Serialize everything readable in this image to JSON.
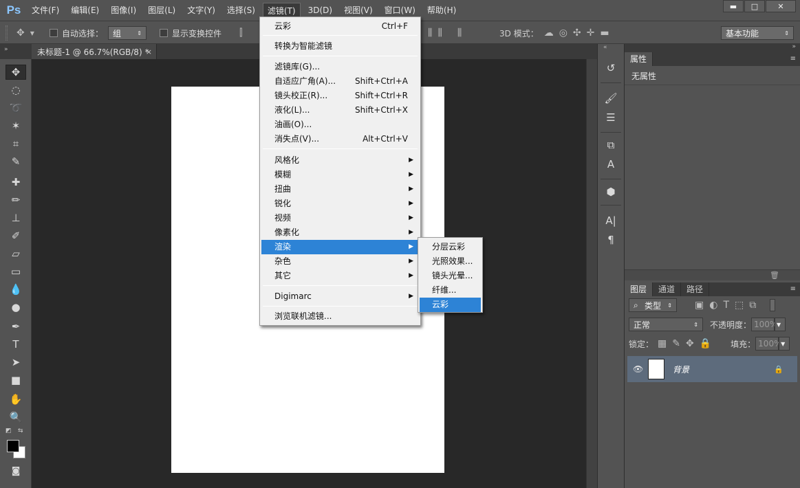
{
  "app": {
    "logo": "Ps"
  },
  "menubar": {
    "items": [
      "文件(F)",
      "编辑(E)",
      "图像(I)",
      "图层(L)",
      "文字(Y)",
      "选择(S)",
      "滤镜(T)",
      "3D(D)",
      "视图(V)",
      "窗口(W)",
      "帮助(H)"
    ],
    "active": "滤镜(T)"
  },
  "window_controls": {
    "minimize": "▬",
    "maximize": "□",
    "close": "✕"
  },
  "options_bar": {
    "auto_select_label": "自动选择：",
    "auto_select_value": "组",
    "show_transform_label": "显示变换控件",
    "mode_3d_label": "3D 模式：",
    "workspace_value": "基本功能"
  },
  "document_tab": {
    "title": "未标题-1 @ 66.7%(RGB/8) *",
    "close": "×"
  },
  "filter_menu": {
    "items": [
      {
        "label": "云彩",
        "shortcut": "Ctrl+F"
      },
      {
        "label": "转换为智能滤镜"
      },
      {
        "label": "滤镜库(G)..."
      },
      {
        "label": "自适应广角(A)...",
        "shortcut": "Shift+Ctrl+A"
      },
      {
        "label": "镜头校正(R)...",
        "shortcut": "Shift+Ctrl+R"
      },
      {
        "label": "液化(L)...",
        "shortcut": "Shift+Ctrl+X"
      },
      {
        "label": "油画(O)..."
      },
      {
        "label": "消失点(V)...",
        "shortcut": "Alt+Ctrl+V"
      },
      {
        "label": "风格化",
        "submenu": true
      },
      {
        "label": "模糊",
        "submenu": true
      },
      {
        "label": "扭曲",
        "submenu": true
      },
      {
        "label": "锐化",
        "submenu": true
      },
      {
        "label": "视频",
        "submenu": true
      },
      {
        "label": "像素化",
        "submenu": true
      },
      {
        "label": "渲染",
        "submenu": true,
        "highlighted": true
      },
      {
        "label": "杂色",
        "submenu": true
      },
      {
        "label": "其它",
        "submenu": true
      },
      {
        "label": "Digimarc",
        "submenu": true
      },
      {
        "label": "浏览联机滤镜..."
      }
    ]
  },
  "render_submenu": {
    "items": [
      {
        "label": "分层云彩"
      },
      {
        "label": "光照效果..."
      },
      {
        "label": "镜头光晕..."
      },
      {
        "label": "纤维..."
      },
      {
        "label": "云彩",
        "highlighted": true
      }
    ]
  },
  "properties_panel": {
    "tab": "属性",
    "content": "无属性"
  },
  "layers_panel": {
    "tabs": [
      "图层",
      "通道",
      "路径"
    ],
    "filter_label": "类型",
    "blend_mode": "正常",
    "opacity_label": "不透明度：",
    "opacity_value": "100%",
    "lock_label": "锁定：",
    "fill_label": "填充：",
    "fill_value": "100%",
    "layer_name": "背景"
  },
  "colors": {
    "menubar_bg": "#535353",
    "highlight": "#2d83d6",
    "canvas_bg": "#282828"
  }
}
